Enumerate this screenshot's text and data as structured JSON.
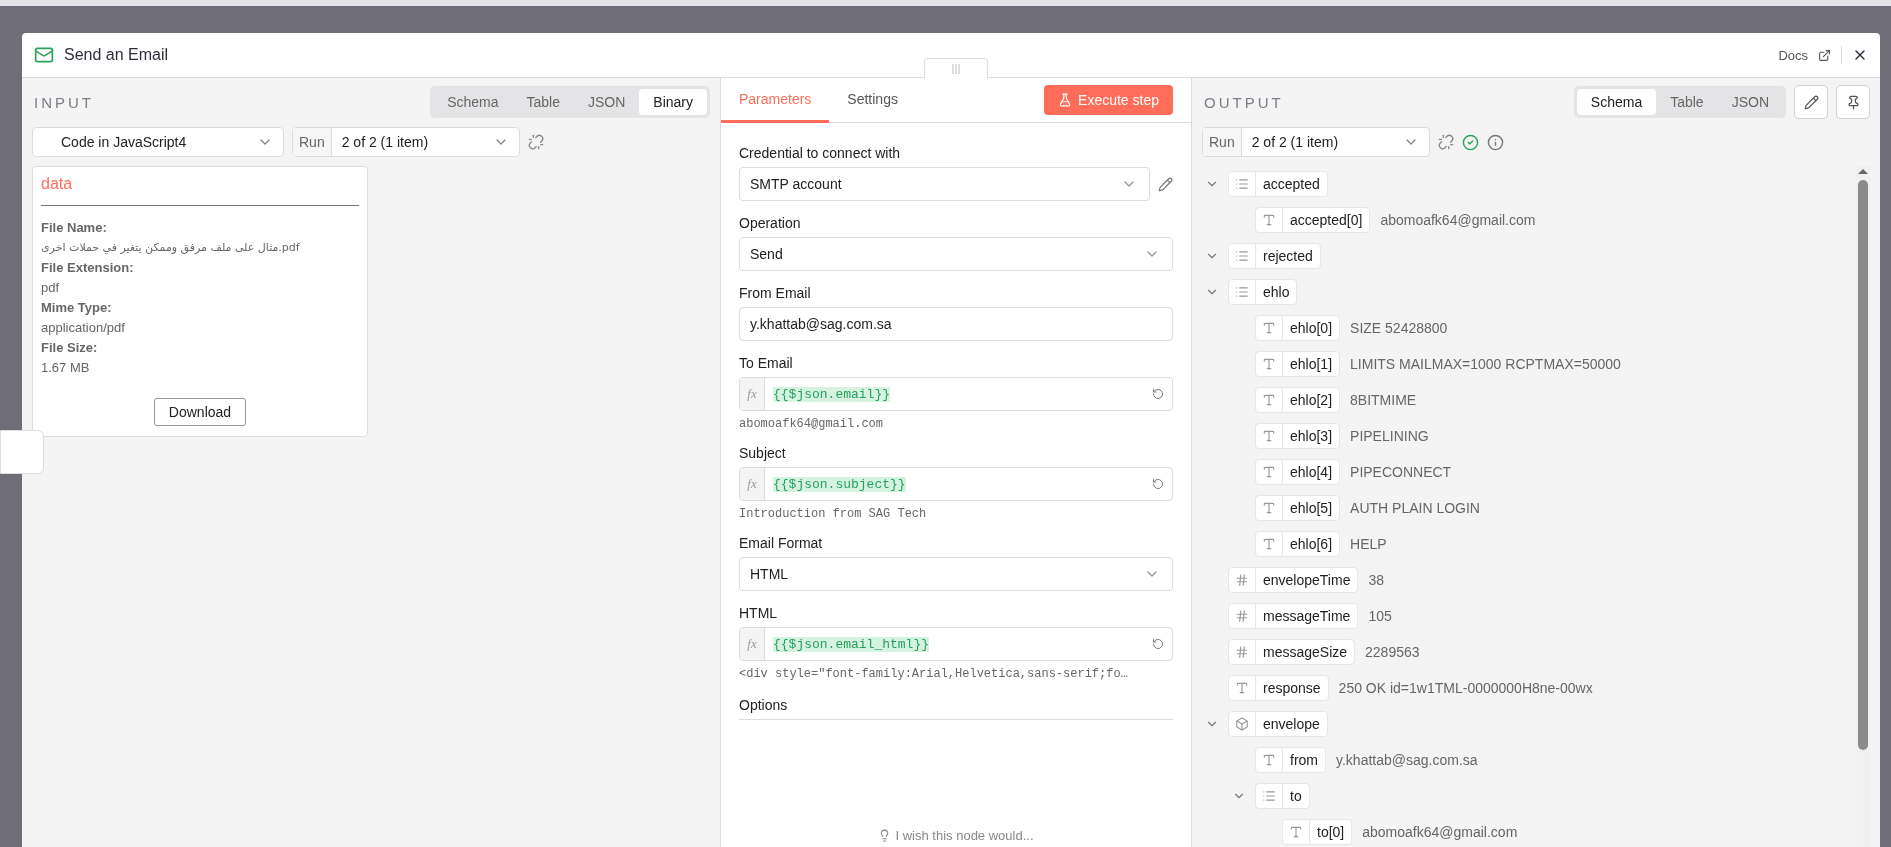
{
  "window": {
    "title": "Send an Email",
    "docs_link": "Docs"
  },
  "input": {
    "heading": "INPUT",
    "view_tabs": [
      {
        "label": "Schema",
        "selected": false
      },
      {
        "label": "Table",
        "selected": false
      },
      {
        "label": "JSON",
        "selected": false
      },
      {
        "label": "Binary",
        "selected": true
      }
    ],
    "node_select": "Code in JavaScript4",
    "run_label": "Run",
    "run_select": "2 of 2 (1 item)",
    "binary": {
      "title": "data",
      "fields": [
        {
          "label": "File Name:",
          "value": "مثال على ملف مرفق وممكن يتغير في حملات اخرى.pdf"
        },
        {
          "label": "File Extension:",
          "value": "pdf"
        },
        {
          "label": "Mime Type:",
          "value": "application/pdf"
        },
        {
          "label": "File Size:",
          "value": "1.67 MB"
        }
      ],
      "download": "Download"
    }
  },
  "parameters": {
    "tabs": [
      {
        "label": "Parameters",
        "selected": true
      },
      {
        "label": "Settings",
        "selected": false
      }
    ],
    "execute_button": "Execute step",
    "fields": [
      {
        "kind": "credential",
        "label": "Credential to connect with",
        "value": "SMTP account"
      },
      {
        "kind": "select",
        "label": "Operation",
        "value": "Send"
      },
      {
        "kind": "text",
        "label": "From Email",
        "value": "y.khattab@sag.com.sa"
      },
      {
        "kind": "expression",
        "label": "To Email",
        "marker": "fx",
        "value": "{{$json.email}}",
        "preview": "abomoafk64@gmail.com"
      },
      {
        "kind": "expression",
        "label": "Subject",
        "marker": "fx",
        "value": "{{$json.subject}}",
        "preview": "Introduction from SAG Tech"
      },
      {
        "kind": "select",
        "label": "Email Format",
        "value": "HTML"
      },
      {
        "kind": "expression",
        "label": "HTML",
        "marker": "fx",
        "value": "{{$json.email_html}}",
        "preview": "<div style=\"font-family:Arial,Helvetica,sans-serif;fo…"
      }
    ],
    "options_label": "Options",
    "feedback": "I wish this node would..."
  },
  "output": {
    "heading": "OUTPUT",
    "view_tabs": [
      {
        "label": "Schema",
        "selected": true
      },
      {
        "label": "Table",
        "selected": false
      },
      {
        "label": "JSON",
        "selected": false
      }
    ],
    "run_label": "Run",
    "run_select": "2 of 2 (1 item)",
    "tree": [
      {
        "kind": "array",
        "key": "accepted",
        "expanded": true,
        "children": [
          {
            "kind": "string",
            "key": "accepted[0]",
            "value": "abomoafk64@gmail.com"
          }
        ]
      },
      {
        "kind": "array",
        "key": "rejected",
        "expanded": true
      },
      {
        "kind": "array",
        "key": "ehlo",
        "expanded": true,
        "children": [
          {
            "kind": "string",
            "key": "ehlo[0]",
            "value": "SIZE 52428800"
          },
          {
            "kind": "string",
            "key": "ehlo[1]",
            "value": "LIMITS MAILMAX=1000 RCPTMAX=50000"
          },
          {
            "kind": "string",
            "key": "ehlo[2]",
            "value": "8BITMIME"
          },
          {
            "kind": "string",
            "key": "ehlo[3]",
            "value": "PIPELINING"
          },
          {
            "kind": "string",
            "key": "ehlo[4]",
            "value": "PIPECONNECT"
          },
          {
            "kind": "string",
            "key": "ehlo[5]",
            "value": "AUTH PLAIN LOGIN"
          },
          {
            "kind": "string",
            "key": "ehlo[6]",
            "value": "HELP"
          }
        ]
      },
      {
        "kind": "number",
        "key": "envelopeTime",
        "value": "38"
      },
      {
        "kind": "number",
        "key": "messageTime",
        "value": "105"
      },
      {
        "kind": "number",
        "key": "messageSize",
        "value": "2289563"
      },
      {
        "kind": "string",
        "key": "response",
        "value": "250 OK id=1w1TML-0000000H8ne-00wx"
      },
      {
        "kind": "object",
        "key": "envelope",
        "expanded": true,
        "children": [
          {
            "kind": "string",
            "key": "from",
            "value": "y.khattab@sag.com.sa"
          },
          {
            "kind": "array",
            "key": "to",
            "expanded": true,
            "children": [
              {
                "kind": "string",
                "key": "to[0]",
                "value": "abomoafk64@gmail.com"
              }
            ]
          }
        ]
      }
    ]
  }
}
